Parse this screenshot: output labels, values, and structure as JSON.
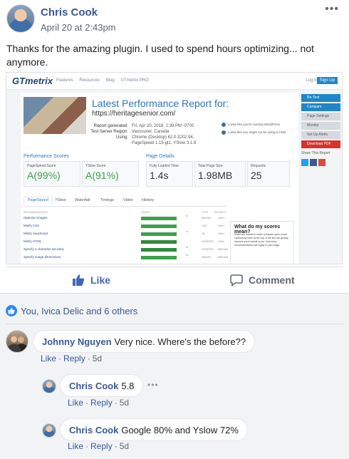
{
  "post": {
    "author": "Chris Cook",
    "timestamp": "April 20 at 2:43pm",
    "menu_icon": "ellipsis-icon",
    "text": "Thanks for the amazing plugin. I used to spend hours optimizing... not anymore."
  },
  "screenshot": {
    "logo": "GTmetrix",
    "nav": [
      "Features",
      "Resources",
      "Blog",
      "GTmetrix PRO"
    ],
    "login": "Log In",
    "signup": "Sign Up",
    "report_title": "Latest Performance Report for:",
    "url": "https://heritagesenior.com/",
    "meta": [
      {
        "k": "Report generated:",
        "v": "Fri, Apr 20, 2018, 2:39 PM -0700"
      },
      {
        "k": "Test Server Region:",
        "v": "Vancouver, Canada"
      },
      {
        "k": "Using:",
        "v": "Chrome (Desktop) 62.0.3202.94, PageSpeed 1.15-gt1, YSlow 3.1.8"
      }
    ],
    "wp_notes": [
      "Looks like you're running WordPress",
      "Looks like you might not be using a CDN"
    ],
    "performance_scores_title": "Performance Scores",
    "pagespeed_label": "PageSpeed Score",
    "pagespeed_value": "A(99%)",
    "yslow_label": "YSlow Score",
    "yslow_value": "A(91%)",
    "page_details_title": "Page Details",
    "load_time_label": "Fully Loaded Time",
    "load_time_value": "1.4s",
    "page_size_label": "Total Page Size",
    "page_size_value": "1.98MB",
    "requests_label": "Requests",
    "requests_value": "25",
    "tabs": [
      "PageSpeed",
      "YSlow",
      "Waterfall",
      "Timings",
      "Video",
      "History"
    ],
    "table_headers": [
      "RECOMMENDATION",
      "GRADE",
      "TYPE",
      "PRIORITY"
    ],
    "rows": [
      {
        "name": "Optimize images",
        "grade": "A (99)",
        "type": "IMAGES",
        "prio": "HIGH"
      },
      {
        "name": "Minify CSS",
        "grade": "A (99)",
        "type": "CSS",
        "prio": "HIGH"
      },
      {
        "name": "Minify JavaScript",
        "grade": "A (99)",
        "type": "JS",
        "prio": "HIGH"
      },
      {
        "name": "Minify HTML",
        "grade": "A (99)",
        "type": "CONTENT",
        "prio": "LOW"
      },
      {
        "name": "Specify a character set early",
        "grade": "A (99)",
        "type": "CONTENT",
        "prio": "MEDIUM"
      },
      {
        "name": "Specify image dimensions",
        "grade": "A (99)",
        "type": "IMAGES",
        "prio": "MEDIUM"
      }
    ],
    "help_title": "What do my scores mean?",
    "help_text": "Rules are sorted in order of impact upon score. Optimizing rules at the top of the list can greatly improve your overall score. Not every recommendation will apply to your page.",
    "side_buttons": [
      "Re-Test",
      "Compare",
      "Page Settings",
      "Monitor",
      "Set Up Alerts",
      "Download PDF"
    ],
    "share_title": "Share This Report"
  },
  "actions": {
    "like": "Like",
    "comment": "Comment"
  },
  "reactions": {
    "text": "You, Ivica Delic and 6 others"
  },
  "comments": [
    {
      "author": "Johnny Nguyen",
      "text": "Very nice. Where's the before??",
      "like": "Like",
      "reply": "Reply",
      "time": "5d"
    },
    {
      "author": "Chris Cook",
      "text": "5.8",
      "like": "Like",
      "reply": "Reply",
      "time": "5d"
    },
    {
      "author": "Chris Cook",
      "text": "Google 80% and Yslow 72%",
      "like": "Like",
      "reply": "Reply",
      "time": "5d"
    }
  ],
  "colors": {
    "link_blue": "#385898",
    "facebook_blue": "#4267b2",
    "gray_text": "#606770",
    "grade_green": "#3ea04a"
  }
}
